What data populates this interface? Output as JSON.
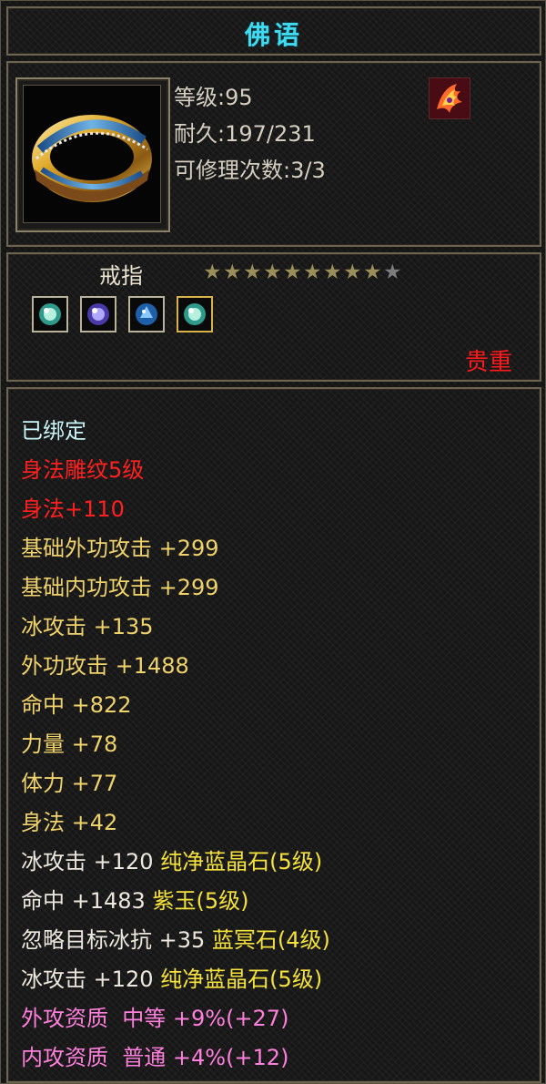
{
  "title": "佛语",
  "item": {
    "level": "等级:95",
    "durability": "耐久:197/231",
    "repair": "可修理次数:3/3",
    "type": "戒指",
    "stars_total": 10,
    "stars_filled": 9,
    "quality": "贵重",
    "gems": [
      "green-gem",
      "purple-gem",
      "blue-gem",
      "green-gem"
    ]
  },
  "stats": [
    {
      "text": "已绑定",
      "color": "#c8f4f8"
    },
    {
      "text": "身法雕纹5级",
      "color": "#ff2020"
    },
    {
      "text": "身法+110",
      "color": "#ff2020"
    },
    {
      "text": "基础外功攻击 +299",
      "color": "#f0d26a"
    },
    {
      "text": "基础内功攻击 +299",
      "color": "#f0d26a"
    },
    {
      "text": "冰攻击 +135",
      "color": "#f0d26a"
    },
    {
      "text": "外功攻击 +1488",
      "color": "#f0d26a"
    },
    {
      "text": "命中 +822",
      "color": "#f0d26a"
    },
    {
      "text": "力量 +78",
      "color": "#f0d26a"
    },
    {
      "text": "体力 +77",
      "color": "#f0d26a"
    },
    {
      "text": "身法 +42",
      "color": "#f0d26a"
    }
  ],
  "gem_stats": [
    {
      "stat": "冰攻击 +120",
      "gem": "纯净蓝晶石(5级)"
    },
    {
      "stat": "命中 +1483",
      "gem": "紫玉(5级)"
    },
    {
      "stat": "忽略目标冰抗 +35",
      "gem": "蓝冥石(4级)"
    },
    {
      "stat": "冰攻击 +120",
      "gem": "纯净蓝晶石(5级)"
    }
  ],
  "aptitude": [
    {
      "text": "外攻资质  中等 +9%(+27)"
    },
    {
      "text": "内攻资质  普通 +4%(+12)"
    }
  ],
  "colors": {
    "title": "#3fd9f0",
    "precious": "#ff1a1a",
    "gem_name": "#f5e23d",
    "aptitude": "#ff7fdc"
  }
}
